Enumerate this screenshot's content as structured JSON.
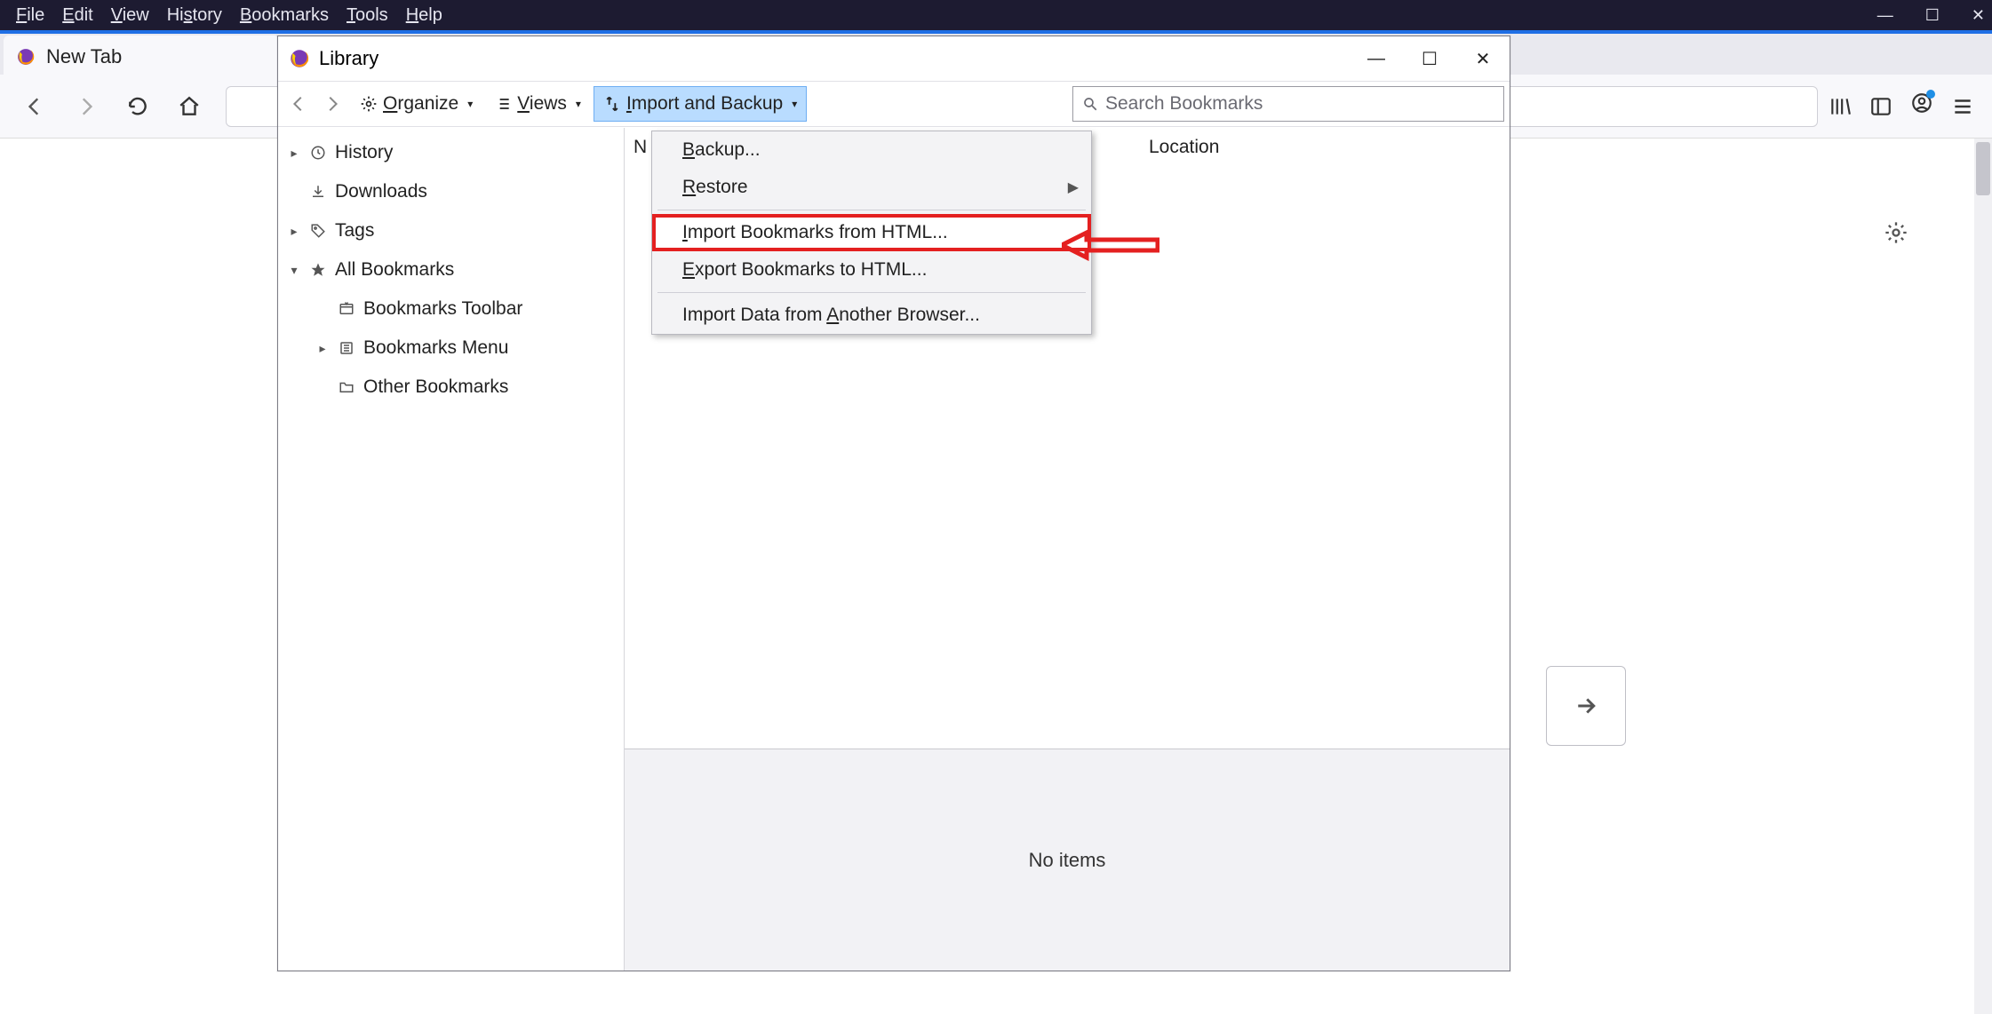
{
  "menubar": {
    "file": "File",
    "edit": "Edit",
    "view": "View",
    "history": "History",
    "bookmarks": "Bookmarks",
    "tools": "Tools",
    "help": "Help"
  },
  "tab": {
    "title": "New Tab"
  },
  "library": {
    "title": "Library",
    "toolbar": {
      "organize": "Organize",
      "views": "Views",
      "import_backup": "Import and Backup"
    },
    "search_placeholder": "Search Bookmarks",
    "sidebar": {
      "history": "History",
      "downloads": "Downloads",
      "tags": "Tags",
      "all_bookmarks": "All Bookmarks",
      "bookmarks_toolbar": "Bookmarks Toolbar",
      "bookmarks_menu": "Bookmarks Menu",
      "other_bookmarks": "Other Bookmarks"
    },
    "columns": {
      "name": "N",
      "location": "Location"
    },
    "detail": "No items"
  },
  "dropdown": {
    "backup": "Backup...",
    "restore": "Restore",
    "import_html": "Import Bookmarks from HTML...",
    "export_html": "Export Bookmarks to HTML...",
    "import_other": "Import Data from Another Browser..."
  }
}
